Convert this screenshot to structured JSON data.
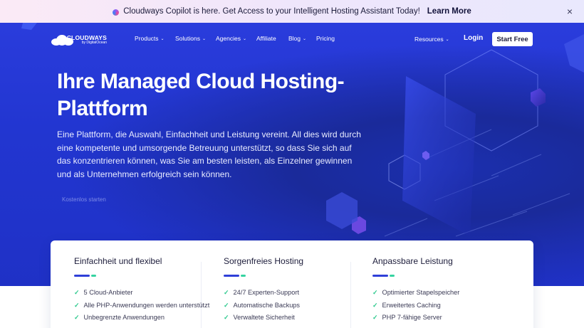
{
  "announcement": {
    "text": "Cloudways Copilot is here. Get Access to your Intelligent Hosting Assistant Today!",
    "link": "Learn More",
    "close_icon": "×"
  },
  "nav": {
    "logo_main": "CLOUDWAYS",
    "logo_sub": "by DigitalOcean",
    "items": [
      {
        "label": "Products",
        "dropdown": true
      },
      {
        "label": "Solutions",
        "dropdown": true
      },
      {
        "label": "Agencies",
        "dropdown": true
      },
      {
        "label": "Affiliate",
        "dropdown": false
      },
      {
        "label": "Blog",
        "dropdown": true
      },
      {
        "label": "Pricing",
        "dropdown": false
      }
    ],
    "resources": "Resources",
    "login": "Login",
    "start_free": "Start Free"
  },
  "hero": {
    "title": "Ihre Managed Cloud Hosting-Plattform",
    "description": "Eine Plattform, die Auswahl, Einfachheit und Leistung vereint. All dies wird durch eine kompetente und umsorgende Betreuung unterstützt, so dass Sie sich auf das konzentrieren können, was Sie am besten leisten, als Einzelner gewinnen und als Unternehmen erfolgreich sein können.",
    "cta": "Kostenlos starten"
  },
  "features": [
    {
      "title": "Einfachheit und flexibel",
      "items": [
        "5 Cloud-Anbieter",
        "Alle PHP-Anwendungen werden unterstützt",
        "Unbegrenzte Anwendungen"
      ]
    },
    {
      "title": "Sorgenfreies Hosting",
      "items": [
        "24/7 Experten-Support",
        "Automatische Backups",
        "Verwaltete Sicherheit"
      ]
    },
    {
      "title": "Anpassbare Leistung",
      "items": [
        "Optimierter Stapelspeicher",
        "Erweitertes Caching",
        "PHP 7-fähige Server"
      ]
    }
  ],
  "colors": {
    "hero_blue": "#2236d1",
    "accent_green": "#35d3a1",
    "bar_blue": "#2f3fd8"
  }
}
